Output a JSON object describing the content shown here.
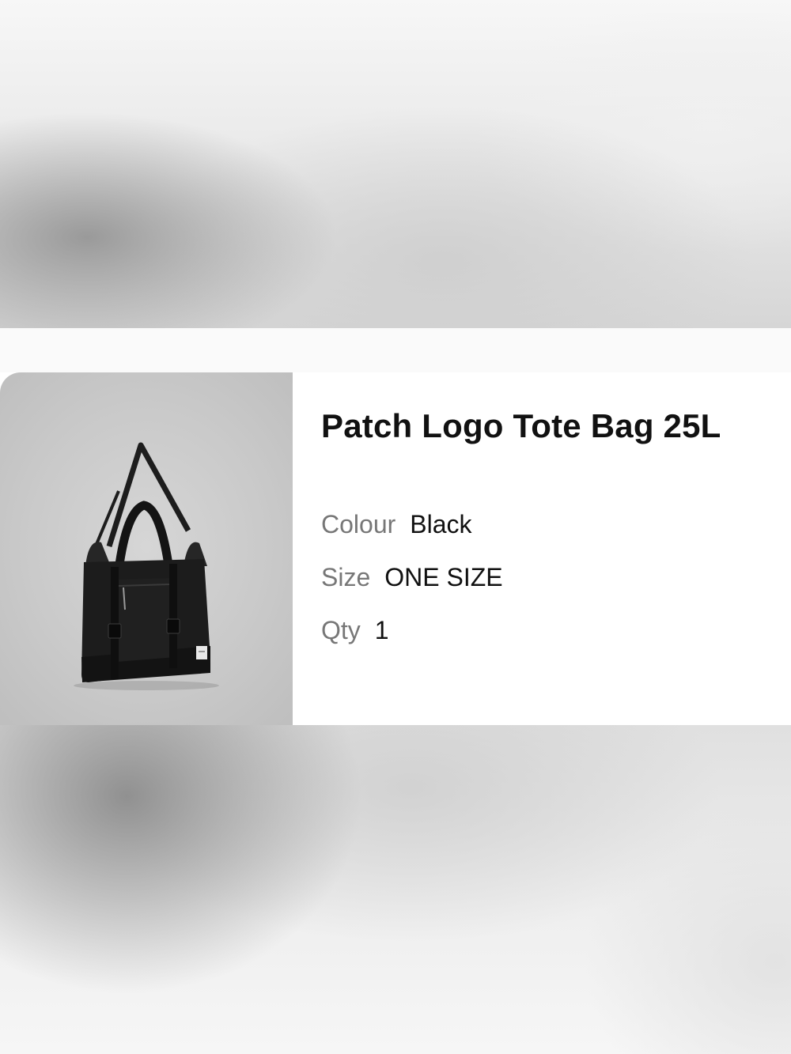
{
  "product": {
    "title": "Patch Logo Tote Bag 25L",
    "image_icon": "tote-bag-product-image",
    "attributes": {
      "colour": {
        "label": "Colour",
        "value": "Black"
      },
      "size": {
        "label": "Size",
        "value": "ONE SIZE"
      },
      "qty": {
        "label": "Qty",
        "value": "1"
      }
    }
  },
  "colors": {
    "title_text": "#111111",
    "label_text": "#777777",
    "card_background": "#ffffff",
    "image_background": "#c9c9c9",
    "bag": "#1b1b1b"
  }
}
